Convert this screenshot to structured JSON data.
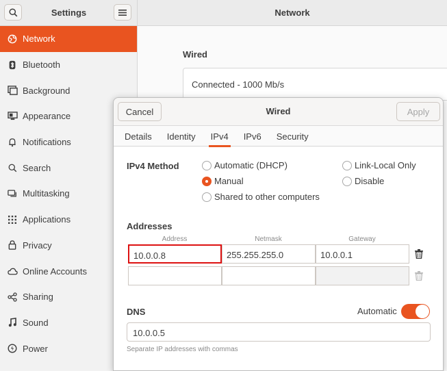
{
  "sidebar": {
    "title": "Settings",
    "items": [
      {
        "label": "Network",
        "icon": "network-icon"
      },
      {
        "label": "Bluetooth",
        "icon": "bluetooth-icon"
      },
      {
        "label": "Background",
        "icon": "background-icon"
      },
      {
        "label": "Appearance",
        "icon": "appearance-icon"
      },
      {
        "label": "Notifications",
        "icon": "bell-icon"
      },
      {
        "label": "Search",
        "icon": "search-icon"
      },
      {
        "label": "Multitasking",
        "icon": "multitasking-icon"
      },
      {
        "label": "Applications",
        "icon": "grid-icon"
      },
      {
        "label": "Privacy",
        "icon": "lock-icon"
      },
      {
        "label": "Online Accounts",
        "icon": "cloud-icon"
      },
      {
        "label": "Sharing",
        "icon": "share-icon"
      },
      {
        "label": "Sound",
        "icon": "music-icon"
      },
      {
        "label": "Power",
        "icon": "power-icon"
      }
    ]
  },
  "main": {
    "title": "Network",
    "section": "Wired",
    "status": "Connected - 1000 Mb/s"
  },
  "dialog": {
    "title": "Wired",
    "cancel": "Cancel",
    "apply": "Apply",
    "tabs": [
      "Details",
      "Identity",
      "IPv4",
      "IPv6",
      "Security"
    ],
    "active_tab": "IPv4",
    "method_label": "IPv4 Method",
    "methods": {
      "automatic": "Automatic (DHCP)",
      "manual": "Manual",
      "shared": "Shared to other computers",
      "link_local": "Link-Local Only",
      "disable": "Disable"
    },
    "selected_method": "Manual",
    "addresses_label": "Addresses",
    "columns": [
      "Address",
      "Netmask",
      "Gateway"
    ],
    "rows": [
      {
        "address": "10.0.0.8",
        "netmask": "255.255.255.0",
        "gateway": "10.0.0.1"
      },
      {
        "address": "",
        "netmask": "",
        "gateway": ""
      }
    ],
    "dns_label": "DNS",
    "dns_automatic_label": "Automatic",
    "dns_automatic": true,
    "dns_value": "10.0.0.5",
    "dns_hint": "Separate IP addresses with commas"
  },
  "colors": {
    "accent": "#e95420",
    "focus_outline": "#dd1111"
  }
}
